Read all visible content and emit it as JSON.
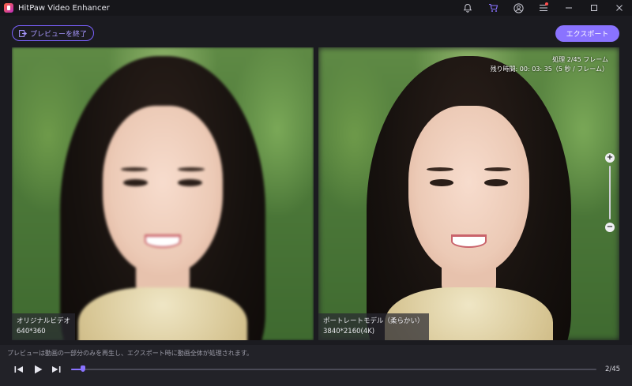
{
  "app": {
    "title": "HitPaw Video Enhancer"
  },
  "title_icons": [
    "bell-icon",
    "cart-icon",
    "account-icon",
    "menu-icon",
    "minimize-icon",
    "maximize-icon",
    "close-icon"
  ],
  "toolbar": {
    "exit_preview_label": "プレビューを終了",
    "export_label": "エクスポート"
  },
  "left_pane": {
    "label": "オリジナルビデオ",
    "resolution": "640*360"
  },
  "right_pane": {
    "label": "ポートレートモデル（柔らかい）",
    "resolution": "3840*2160(4K)",
    "progress_line1": "処理 2/45 フレーム",
    "progress_line2": "残り時間: 00: 03: 35（5 秒 / フレーム）"
  },
  "bottom": {
    "notice": "プレビューは動画の一部分のみを再生し、エクスポート時に動画全体が処理されます。",
    "frame_count": "2/45",
    "progress_fraction": 0.022
  },
  "colors": {
    "accent": "#8a73ff",
    "notification_dot": "#ff4d4d"
  }
}
